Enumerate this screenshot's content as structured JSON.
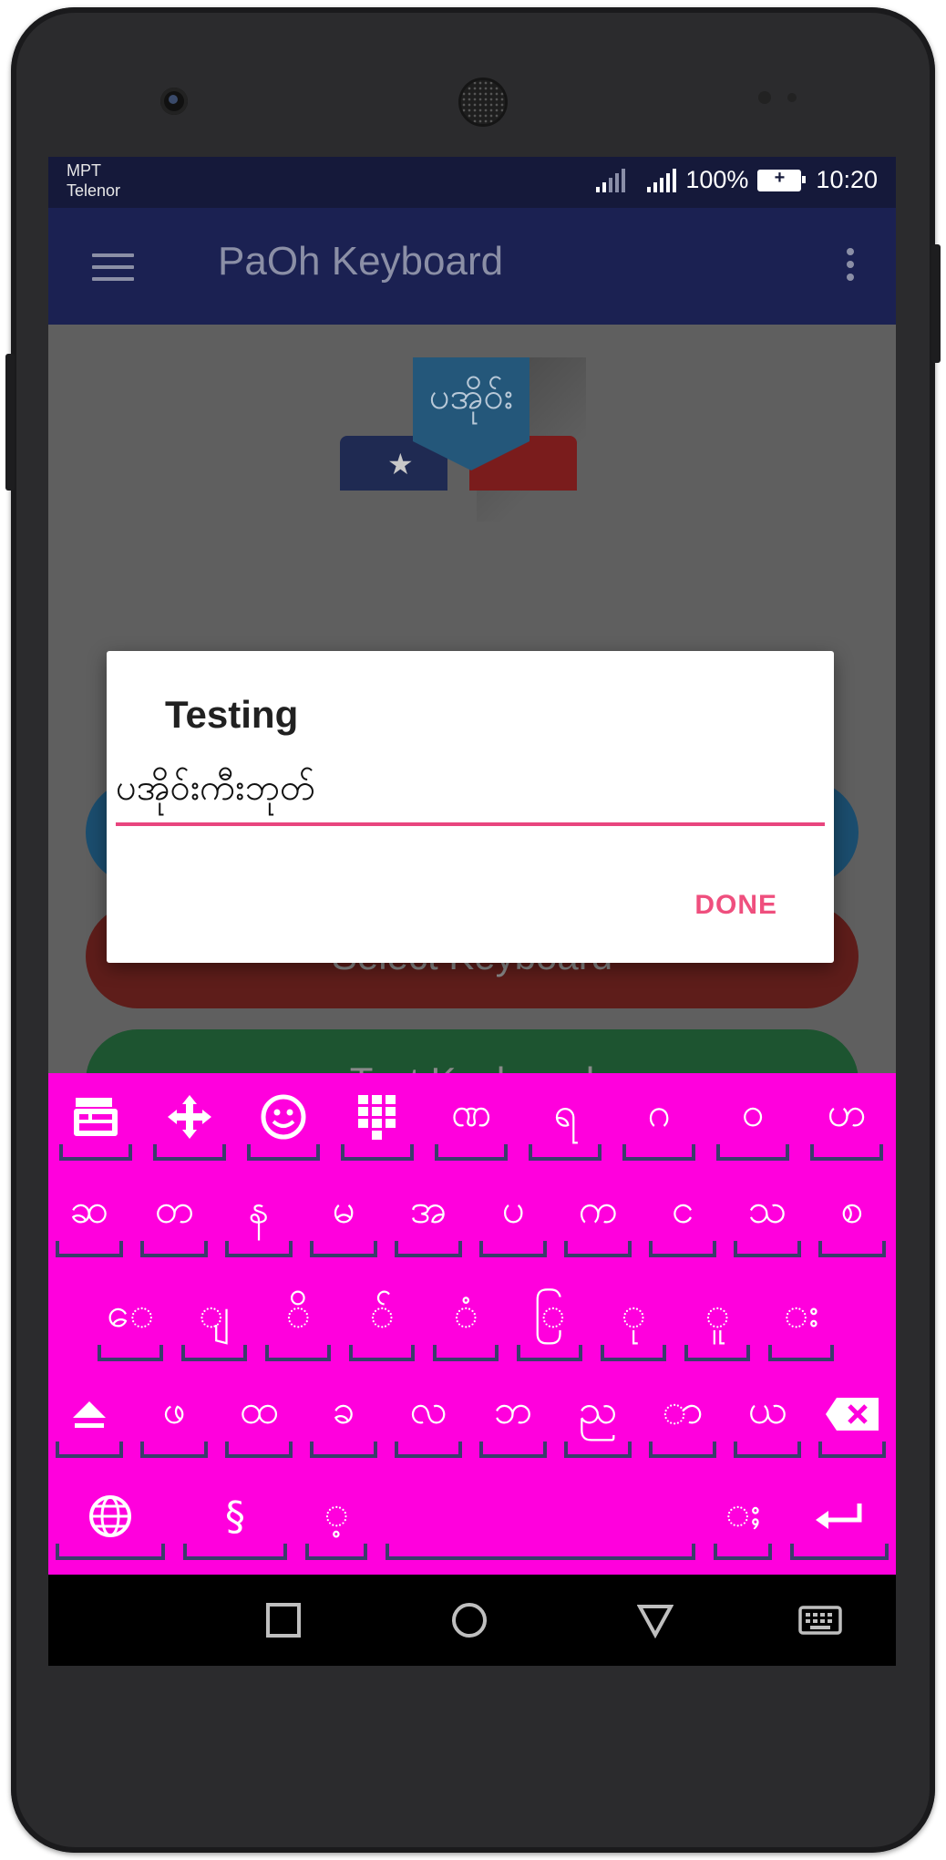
{
  "status_bar": {
    "carrier_1": "MPT",
    "carrier_2": "Telenor",
    "battery": "100%",
    "time": "10:20"
  },
  "app_bar": {
    "title": "PaOh Keyboard",
    "menu_icon": "hamburger-menu-icon",
    "overflow_icon": "more-vert-icon"
  },
  "logo": {
    "text": "ပအိုဝ်း"
  },
  "buttons": {
    "select_keyboard": "Select Keyboard",
    "test_keyboard": "Test Keyboard"
  },
  "dialog": {
    "title": "Testing",
    "input_value": "ပအိုဝ်းကီးဘုတ်",
    "done_label": "DONE"
  },
  "keyboard": {
    "background_color": "#ff00dd",
    "row1": [
      "clipboard-icon",
      "move-icon",
      "emoji-icon",
      "numpad-icon",
      "ဏ",
      "ရ",
      "ဂ",
      "ဝ",
      "ဟ"
    ],
    "row2": [
      "ဆ",
      "တ",
      "န",
      "မ",
      "အ",
      "ပ",
      "က",
      "င",
      "သ",
      "စ"
    ],
    "row3": [
      "ေ",
      "ျ",
      "ိ",
      "်",
      "ံ",
      "ြ",
      "ု",
      "ူ",
      "း"
    ],
    "row4": [
      "shift-icon",
      "ဖ",
      "ထ",
      "ခ",
      "လ",
      "ဘ",
      "ည",
      "ာ",
      "ယ",
      "backspace-icon"
    ],
    "row5": [
      "globe-icon",
      "§",
      "့",
      "space",
      "ႈ",
      "enter-icon"
    ]
  },
  "nav_bar": {
    "recents": "square-recents-icon",
    "home": "circle-home-icon",
    "back": "triangle-back-icon",
    "keyboard": "keyboard-switch-icon"
  }
}
